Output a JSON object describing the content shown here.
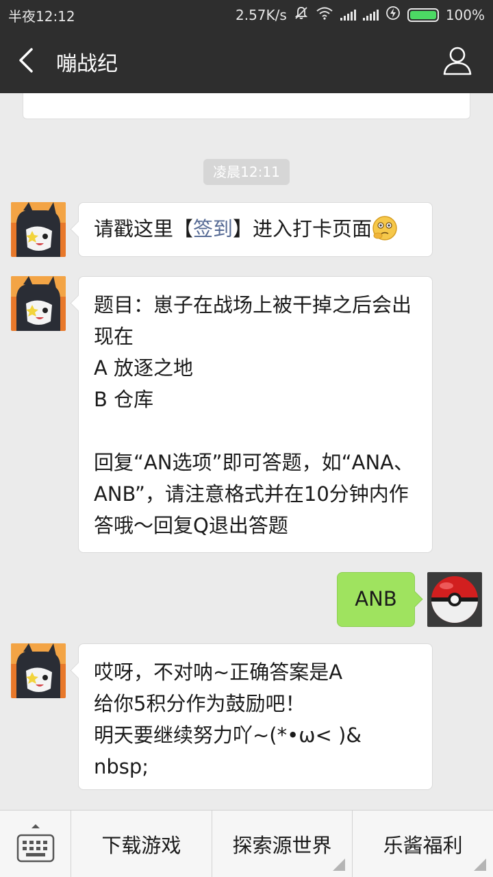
{
  "status_bar": {
    "time": "半夜12:12",
    "network_speed": "2.57K/s",
    "battery": "100%"
  },
  "nav": {
    "title": "嘣战纪"
  },
  "chat": {
    "timestamp": "凌晨12:11",
    "messages": [
      {
        "side": "left",
        "text_before": "请戳这里【",
        "link": "签到",
        "text_after": "】进入打卡页面"
      },
      {
        "side": "left",
        "text": "题目：崽子在战场上被干掉之后会出现在\nA 放逐之地\nB 仓库\n\n回复“AN选项”即可答题，如“ANA、ANB”，请注意格式并在10分钟内作答哦～回复Q退出答题"
      },
      {
        "side": "right",
        "text": "ANB"
      },
      {
        "side": "left",
        "text": "哎呀，不对呐~正确答案是A\n给你5积分作为鼓励吧！\n明天要继续努力吖~(*•ω< )&nbsp;"
      }
    ]
  },
  "menu": {
    "items": [
      "下载游戏",
      "探索源世界",
      "乐酱福利"
    ]
  },
  "colors": {
    "nav_background": "#2e2e2e",
    "chat_background": "#ebebeb",
    "sent_bubble": "#9fe35f",
    "link": "#576b95",
    "battery_fill": "#4cd964"
  }
}
